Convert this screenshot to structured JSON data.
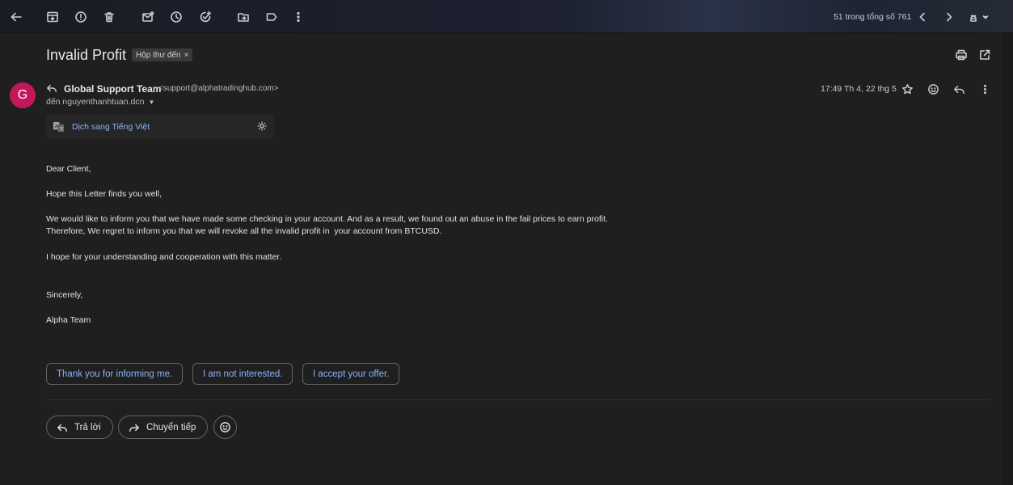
{
  "toolbar": {
    "icons": [
      "back-arrow-icon",
      "archive-icon",
      "report-spam-icon",
      "delete-icon",
      "mark-unread-icon",
      "snooze-icon",
      "add-task-icon",
      "move-to-icon",
      "label-icon",
      "more-vert-icon"
    ],
    "counter": "51 trong tổng số 761"
  },
  "email": {
    "subject": "Invalid Profit",
    "label": "Hộp thư đến",
    "label_remove": "×",
    "avatar_letter": "G",
    "avatar_color": "#c2185b",
    "sender_name": "Global Support Team",
    "sender_email": "<support@alphatradinghub.com>",
    "recipient": "đến nguyenthanhtuan.dcn",
    "timestamp": "17:49 Th 4, 22 thg 5",
    "translate_label": "Dịch sang Tiếng Việt",
    "body": {
      "greeting": "Dear Client,",
      "line1": "Hope this Letter finds you well,",
      "line2": "We would like to inform you that we have made some checking in your account. And as a result, we found out an abuse in the fail prices to earn profit.",
      "line3": "Therefore, We regret to inform you that we will revoke all the invalid profit in  your account from BTCUSD.",
      "line4": "I hope for your understanding and cooperation with this matter.",
      "closing": "Sincerely,",
      "signature": "Alpha Team"
    }
  },
  "smart_replies": [
    "Thank you for informing me.",
    "I am not interested.",
    "I accept your offer."
  ],
  "actions": {
    "reply": "Trả lời",
    "forward": "Chuyển tiếp"
  },
  "colors": {
    "link": "#8ab4f8",
    "background": "#1f1f1f"
  }
}
